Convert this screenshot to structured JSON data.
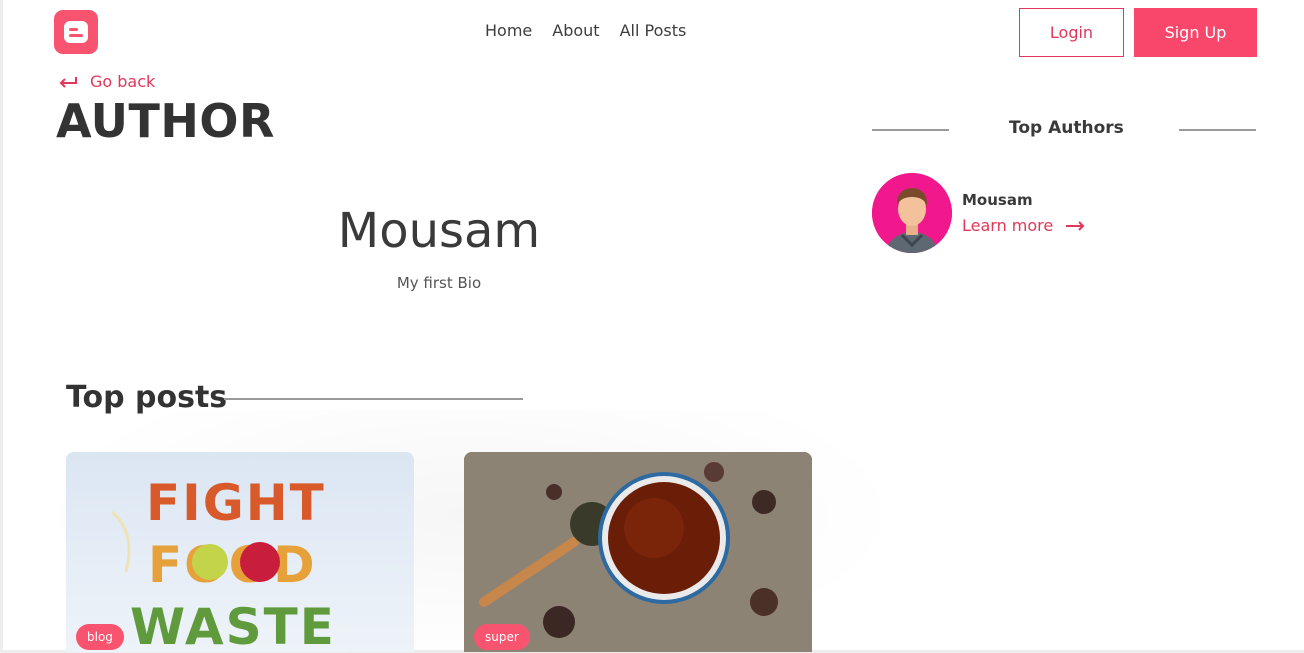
{
  "nav": {
    "links": [
      {
        "label": "Home"
      },
      {
        "label": "About"
      },
      {
        "label": "All Posts"
      }
    ],
    "login_label": "Login",
    "signup_label": "Sign Up"
  },
  "page": {
    "go_back_label": "Go back",
    "title": "AUTHOR"
  },
  "author": {
    "name": "Mousam",
    "bio": "My first Bio"
  },
  "top_authors": {
    "title": "Top Authors",
    "items": [
      {
        "name": "Mousam",
        "link_label": "Learn more"
      }
    ]
  },
  "top_posts": {
    "title": "Top posts",
    "posts": [
      {
        "tag": "blog",
        "image_text": [
          "FIGHT",
          "FOOD",
          "WASTE"
        ]
      },
      {
        "tag": "super"
      }
    ]
  },
  "colors": {
    "accent": "#f8476a",
    "accent_text": "#e0375a",
    "avatar_bg": "#f0188c"
  },
  "icons": {
    "logo": "blogger-logo-icon",
    "back": "arrow-left-return-icon",
    "learn_more": "arrow-right-icon"
  }
}
